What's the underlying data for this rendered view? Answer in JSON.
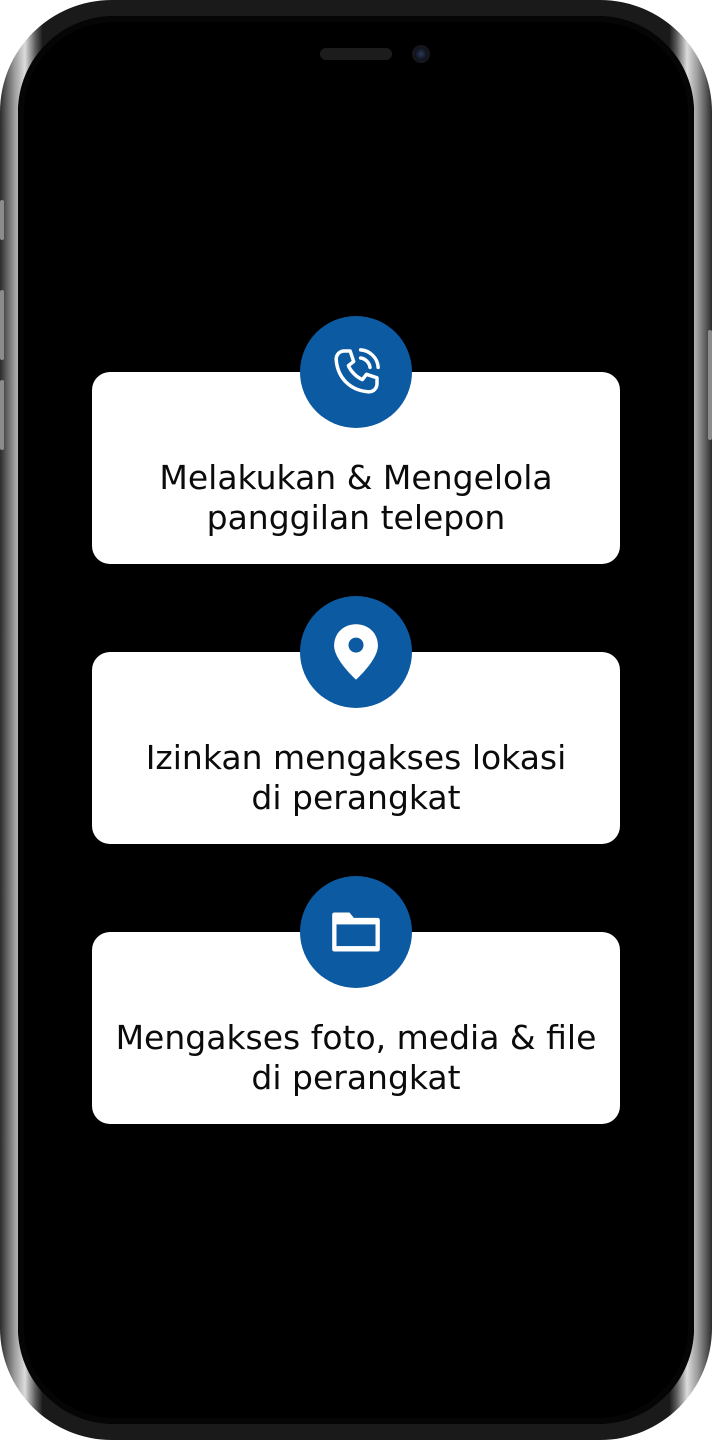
{
  "theme": {
    "accent": "#0b5aa2",
    "card_background": "#ffffff",
    "screen_background": "#000000",
    "text_color": "#0b0b0b"
  },
  "permissions": [
    {
      "icon": "phone-call-icon",
      "line1": "Melakukan & Mengelola",
      "line2": "panggilan telepon"
    },
    {
      "icon": "location-pin-icon",
      "line1": "Izinkan mengakses lokasi",
      "line2": "di perangkat"
    },
    {
      "icon": "folder-icon",
      "line1": "Mengakses foto, media & file",
      "line2": "di perangkat"
    }
  ]
}
